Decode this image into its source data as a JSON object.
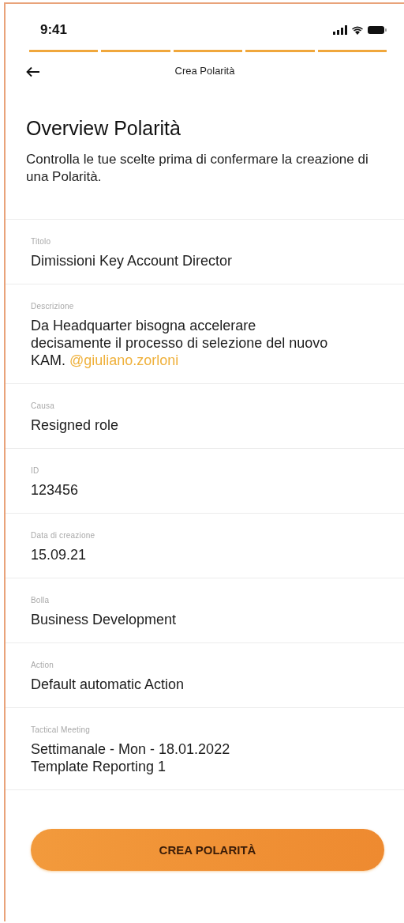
{
  "status_bar": {
    "time": "9:41"
  },
  "progress_steps": [
    {
      "completed": true
    },
    {
      "completed": true
    },
    {
      "completed": true
    },
    {
      "completed": true
    },
    {
      "completed": true
    }
  ],
  "header": {
    "title": "Crea Polarità"
  },
  "heading": "Overview Polarità",
  "intro": "Controlla le tue scelte prima di confermare la creazione di una Polarità.",
  "fields": [
    {
      "label": "Titolo",
      "lines": [
        "Dimissioni Key Account Director"
      ]
    },
    {
      "label": "Descrizione",
      "text": "Da Headquarter bisogna accelerare decisamente il processo di selezione del nuovo KAM.",
      "mention": "@giuliano.zorloni"
    },
    {
      "label": "Causa",
      "lines": [
        "Resigned role"
      ]
    },
    {
      "label": "ID",
      "lines": [
        "123456"
      ]
    },
    {
      "label": "Data di creazione",
      "lines": [
        "15.09.21"
      ]
    },
    {
      "label": "Bolla",
      "lines": [
        "Business Development"
      ]
    },
    {
      "label": "Action",
      "lines": [
        "Default automatic Action"
      ]
    },
    {
      "label": "Tactical Meeting",
      "lines": [
        "Settimanale - Mon - 18.01.2022",
        "Template Reporting 1"
      ]
    }
  ],
  "primary_button": "CREA POLARITÀ"
}
